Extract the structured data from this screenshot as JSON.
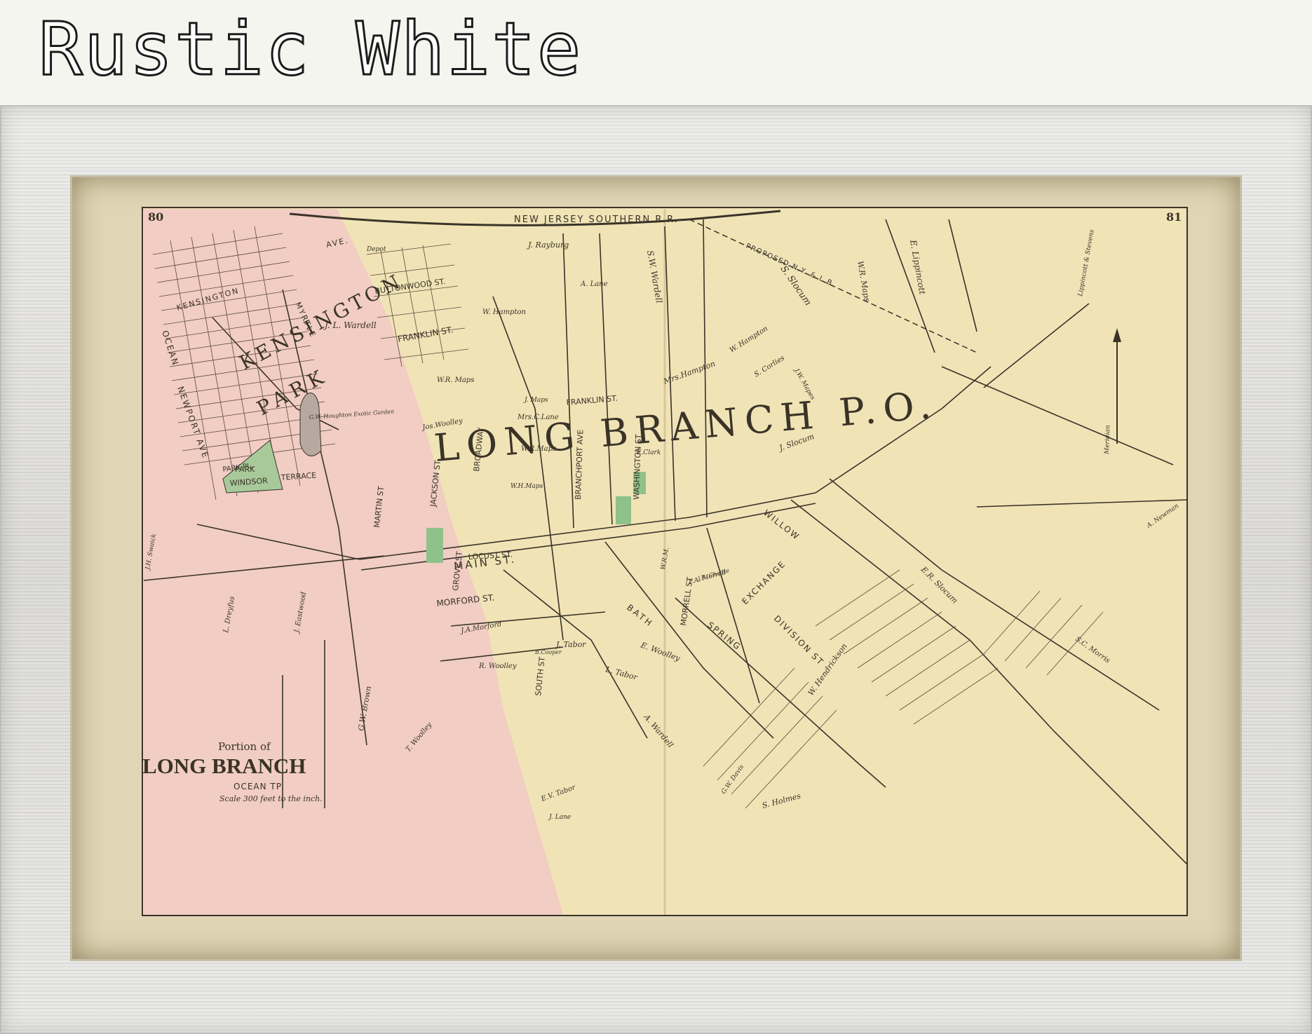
{
  "header": {
    "title": "Rustic White"
  },
  "map": {
    "page_numbers": {
      "left": "80",
      "right": "81"
    },
    "title_block": {
      "portion_of": "Portion of",
      "place": "LONG BRANCH",
      "township": "OCEAN TP",
      "scale": "Scale 300 feet to the inch."
    },
    "railroad": "NEW JERSEY SOUTHERN R.R.",
    "proposed_railroad": "PROPOSED N.Y. & L.B.",
    "post_office": "LONG BRANCH P.O.",
    "kensington_park": [
      "KENSINGTON",
      "PARK"
    ],
    "streets": {
      "main": "MAIN ST.",
      "buttonwood": "BUTTONWOOD ST.",
      "franklin_left": "FRANKLIN ST.",
      "franklin_center": "FRANKLIN ST.",
      "locust": "LOCUST ST.",
      "morford": "MORFORD ST.",
      "windsor": "WINDSOR",
      "terrace": "TERRACE",
      "park_pl": "PARK PL.",
      "newport_ave": "NEWPORT AVE",
      "ocean_ave": "OCEAN",
      "kensington": "KENSINGTON",
      "jackson": "JACKSON ST",
      "martin": "MARTIN ST",
      "grove": "GROVE ST",
      "broadway": "BROADWAY",
      "branchport": "BRANCHPORT AVE",
      "washington": "WASHINGTON ST",
      "morrell": "MORRELL ST",
      "exchange": "EXCHANGE",
      "spring": "SPRING",
      "division": "DIVISION ST",
      "willow": "WILLOW",
      "bath": "BATH",
      "south": "SOUTH ST",
      "myrtle": "MYRTLE",
      "ave": "AVE."
    },
    "areas": {
      "park": "PARK",
      "garden": "G.W. Houghton Exotic Garden"
    },
    "owners": [
      "J. L. Wardell",
      "W.R. Maps",
      "W. Hampton",
      "Mrs.C.Lane",
      "J. Rayburg",
      "A. Lane",
      "Mrs.Hampton",
      "S. Slocum",
      "S.W. Wardell",
      "W.R. Maps",
      "E. Lippincott",
      "W. Hampton",
      "S. Corlies",
      "J. Slocum",
      "J.W. Mapes",
      "J. Maps",
      "W.R.Maps",
      "Jos.Woolley",
      "E.Clark",
      "J.A.Morford",
      "W.H.Maps",
      "E. Woolley",
      "J. Tabor",
      "L. Tabor",
      "A. Wardell",
      "G.W. Brown",
      "T. Woolley",
      "J.H. Swaick",
      "L. Dreyfus",
      "J. Eastwood",
      "E.R. Slocum",
      "S.C. Morris",
      "W. Hendrickson",
      "S. Holmes",
      "G.W. Davis",
      "R. Woolley",
      "E.V. Tabor",
      "J. Lane",
      "F.A. Morrell",
      "W.R.M.",
      "B.Cooper",
      "A. Newman",
      "Lippincott & Stevens",
      "Meridian",
      "Depot",
      "J.R. Chattle"
    ],
    "colors": {
      "paper": "#f0e3b6",
      "kensington_pink": "#f1cdc3",
      "park_green": "#a8c99a",
      "ink": "#3a3328"
    }
  }
}
